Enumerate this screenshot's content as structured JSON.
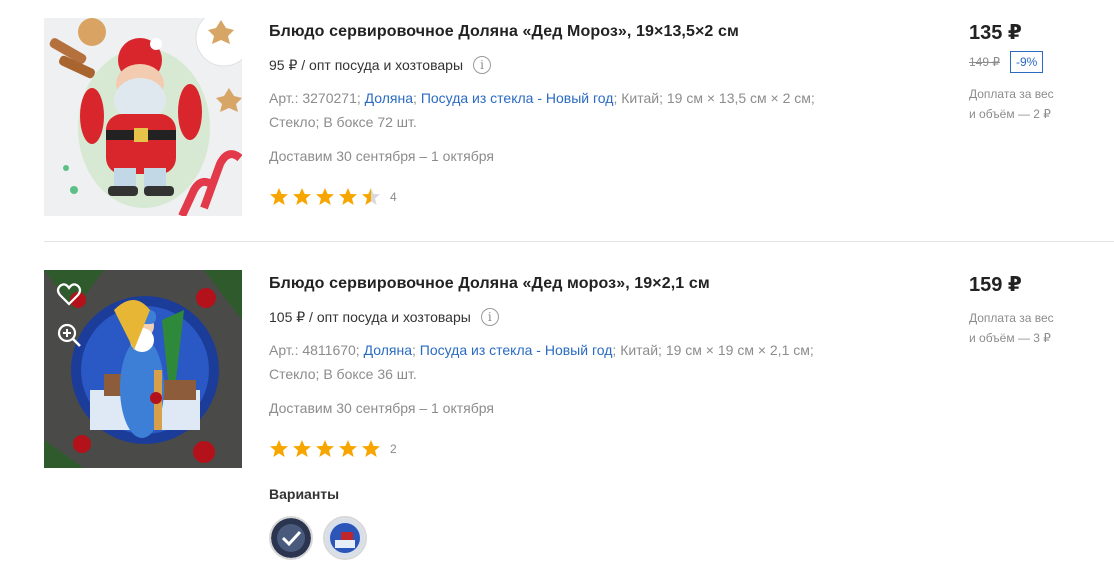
{
  "products": [
    {
      "title": "Блюдо сервировочное Доляна «Дед Мороз», 19×13,5×2 см",
      "wholesale": "95 ₽ / опт посуда и хозтовары",
      "info_icon": "info-icon",
      "specs": {
        "article": "Арт.: 3270271;",
        "brand": "Доляна",
        "category": "Посуда из стекла - Новый год",
        "country": "Китай;",
        "size": "19 см × 13,5 см × 2 см;",
        "material": "Стекло;",
        "box": "В боксе 72 шт."
      },
      "delivery": "Доставим 30 сентября – 1 октября",
      "rating": 4.5,
      "rating_count": "4",
      "price": "135 ₽",
      "old_price": "149 ₽",
      "discount": "-9%",
      "extra_line1": "Доплата за вес",
      "extra_line2": "и объём — 2 ₽"
    },
    {
      "title": "Блюдо сервировочное Доляна «Дед мороз», 19×2,1 см",
      "wholesale": "105 ₽ / опт посуда и хозтовары",
      "info_icon": "info-icon",
      "specs": {
        "article": "Арт.: 4811670;",
        "brand": "Доляна",
        "category": "Посуда из стекла - Новый год",
        "country": "Китай;",
        "size": "19 см × 19 см × 2,1 см;",
        "material": "Стекло;",
        "box": "В боксе 36 шт."
      },
      "delivery": "Доставим 30 сентября – 1 октября",
      "rating": 5,
      "rating_count": "2",
      "price": "159 ₽",
      "extra_line1": "Доплата за вес",
      "extra_line2": "и объём — 3 ₽",
      "variants_title": "Варианты",
      "overlay_icons": [
        "heart-icon",
        "zoom-icon"
      ]
    }
  ],
  "colors": {
    "link": "#2a6bc1",
    "star": "#f7a600",
    "muted": "#8c8c8c"
  }
}
